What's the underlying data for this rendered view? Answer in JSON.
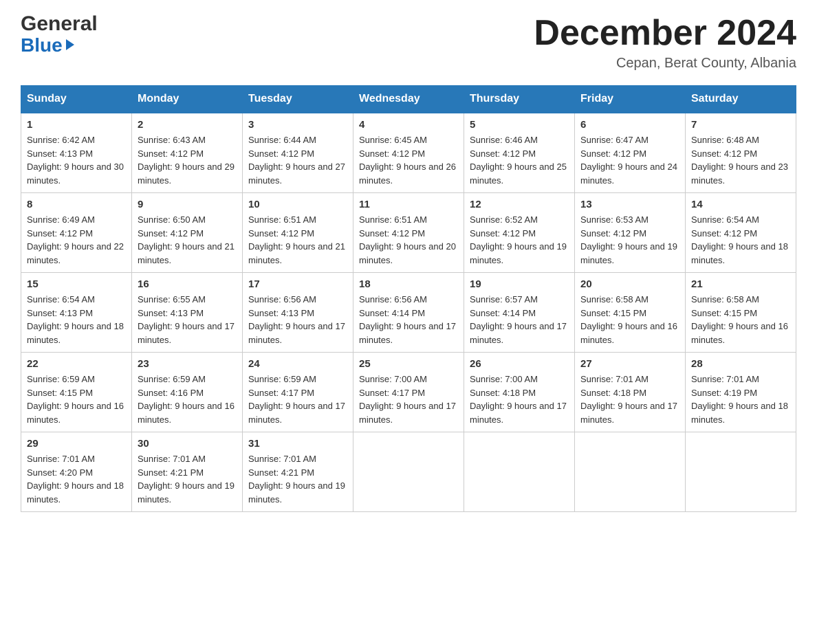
{
  "header": {
    "logo_general": "General",
    "logo_blue": "Blue",
    "month_title": "December 2024",
    "subtitle": "Cepan, Berat County, Albania"
  },
  "weekdays": [
    "Sunday",
    "Monday",
    "Tuesday",
    "Wednesday",
    "Thursday",
    "Friday",
    "Saturday"
  ],
  "weeks": [
    [
      {
        "day": "1",
        "sunrise": "6:42 AM",
        "sunset": "4:13 PM",
        "daylight": "9 hours and 30 minutes."
      },
      {
        "day": "2",
        "sunrise": "6:43 AM",
        "sunset": "4:12 PM",
        "daylight": "9 hours and 29 minutes."
      },
      {
        "day": "3",
        "sunrise": "6:44 AM",
        "sunset": "4:12 PM",
        "daylight": "9 hours and 27 minutes."
      },
      {
        "day": "4",
        "sunrise": "6:45 AM",
        "sunset": "4:12 PM",
        "daylight": "9 hours and 26 minutes."
      },
      {
        "day": "5",
        "sunrise": "6:46 AM",
        "sunset": "4:12 PM",
        "daylight": "9 hours and 25 minutes."
      },
      {
        "day": "6",
        "sunrise": "6:47 AM",
        "sunset": "4:12 PM",
        "daylight": "9 hours and 24 minutes."
      },
      {
        "day": "7",
        "sunrise": "6:48 AM",
        "sunset": "4:12 PM",
        "daylight": "9 hours and 23 minutes."
      }
    ],
    [
      {
        "day": "8",
        "sunrise": "6:49 AM",
        "sunset": "4:12 PM",
        "daylight": "9 hours and 22 minutes."
      },
      {
        "day": "9",
        "sunrise": "6:50 AM",
        "sunset": "4:12 PM",
        "daylight": "9 hours and 21 minutes."
      },
      {
        "day": "10",
        "sunrise": "6:51 AM",
        "sunset": "4:12 PM",
        "daylight": "9 hours and 21 minutes."
      },
      {
        "day": "11",
        "sunrise": "6:51 AM",
        "sunset": "4:12 PM",
        "daylight": "9 hours and 20 minutes."
      },
      {
        "day": "12",
        "sunrise": "6:52 AM",
        "sunset": "4:12 PM",
        "daylight": "9 hours and 19 minutes."
      },
      {
        "day": "13",
        "sunrise": "6:53 AM",
        "sunset": "4:12 PM",
        "daylight": "9 hours and 19 minutes."
      },
      {
        "day": "14",
        "sunrise": "6:54 AM",
        "sunset": "4:12 PM",
        "daylight": "9 hours and 18 minutes."
      }
    ],
    [
      {
        "day": "15",
        "sunrise": "6:54 AM",
        "sunset": "4:13 PM",
        "daylight": "9 hours and 18 minutes."
      },
      {
        "day": "16",
        "sunrise": "6:55 AM",
        "sunset": "4:13 PM",
        "daylight": "9 hours and 17 minutes."
      },
      {
        "day": "17",
        "sunrise": "6:56 AM",
        "sunset": "4:13 PM",
        "daylight": "9 hours and 17 minutes."
      },
      {
        "day": "18",
        "sunrise": "6:56 AM",
        "sunset": "4:14 PM",
        "daylight": "9 hours and 17 minutes."
      },
      {
        "day": "19",
        "sunrise": "6:57 AM",
        "sunset": "4:14 PM",
        "daylight": "9 hours and 17 minutes."
      },
      {
        "day": "20",
        "sunrise": "6:58 AM",
        "sunset": "4:15 PM",
        "daylight": "9 hours and 16 minutes."
      },
      {
        "day": "21",
        "sunrise": "6:58 AM",
        "sunset": "4:15 PM",
        "daylight": "9 hours and 16 minutes."
      }
    ],
    [
      {
        "day": "22",
        "sunrise": "6:59 AM",
        "sunset": "4:15 PM",
        "daylight": "9 hours and 16 minutes."
      },
      {
        "day": "23",
        "sunrise": "6:59 AM",
        "sunset": "4:16 PM",
        "daylight": "9 hours and 16 minutes."
      },
      {
        "day": "24",
        "sunrise": "6:59 AM",
        "sunset": "4:17 PM",
        "daylight": "9 hours and 17 minutes."
      },
      {
        "day": "25",
        "sunrise": "7:00 AM",
        "sunset": "4:17 PM",
        "daylight": "9 hours and 17 minutes."
      },
      {
        "day": "26",
        "sunrise": "7:00 AM",
        "sunset": "4:18 PM",
        "daylight": "9 hours and 17 minutes."
      },
      {
        "day": "27",
        "sunrise": "7:01 AM",
        "sunset": "4:18 PM",
        "daylight": "9 hours and 17 minutes."
      },
      {
        "day": "28",
        "sunrise": "7:01 AM",
        "sunset": "4:19 PM",
        "daylight": "9 hours and 18 minutes."
      }
    ],
    [
      {
        "day": "29",
        "sunrise": "7:01 AM",
        "sunset": "4:20 PM",
        "daylight": "9 hours and 18 minutes."
      },
      {
        "day": "30",
        "sunrise": "7:01 AM",
        "sunset": "4:21 PM",
        "daylight": "9 hours and 19 minutes."
      },
      {
        "day": "31",
        "sunrise": "7:01 AM",
        "sunset": "4:21 PM",
        "daylight": "9 hours and 19 minutes."
      },
      null,
      null,
      null,
      null
    ]
  ]
}
